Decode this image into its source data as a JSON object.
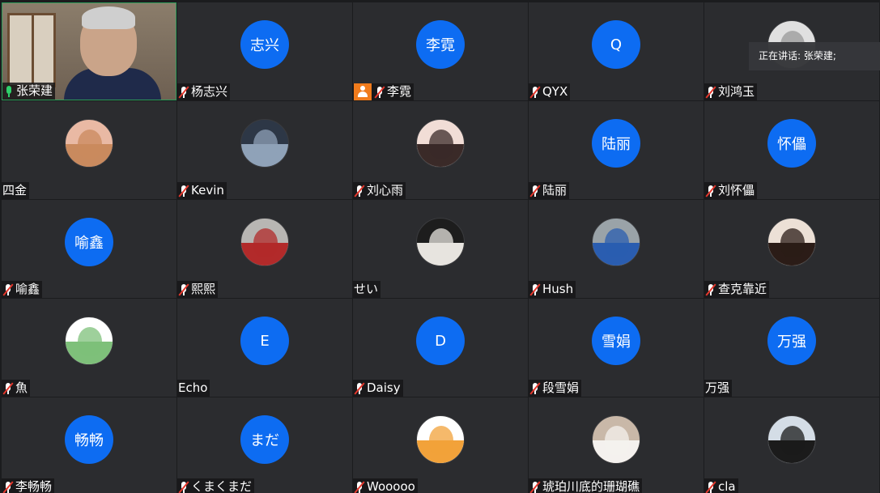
{
  "speaking_indicator": {
    "label": "正在讲话: 张荣建;"
  },
  "participants": [
    {
      "name": "张荣建",
      "kind": "video",
      "mic": "on",
      "active": true
    },
    {
      "name": "杨志兴",
      "kind": "initials",
      "initials": "志兴",
      "mic": "muted"
    },
    {
      "name": "李霓",
      "kind": "initials",
      "initials": "李霓",
      "mic": "muted",
      "host": true
    },
    {
      "name": "QYX",
      "kind": "initials",
      "initials": "Q",
      "mic": "muted"
    },
    {
      "name": "刘鸿玉",
      "kind": "photo",
      "mic": "muted",
      "photo_colors": [
        "#e0e0e0",
        "#9a9a9a"
      ]
    },
    {
      "name": "四金",
      "kind": "photo",
      "mic": "none",
      "photo_colors": [
        "#e9b9a4",
        "#c98a5e"
      ]
    },
    {
      "name": "Kevin",
      "kind": "photo",
      "mic": "muted",
      "photo_colors": [
        "#2d3746",
        "#8fa2b8"
      ]
    },
    {
      "name": "刘心雨",
      "kind": "photo",
      "mic": "muted",
      "photo_colors": [
        "#f1ddd6",
        "#3a2a28"
      ]
    },
    {
      "name": "陆丽",
      "kind": "initials",
      "initials": "陆丽",
      "mic": "muted"
    },
    {
      "name": "刘怀儡",
      "kind": "initials",
      "initials": "怀儡",
      "mic": "muted"
    },
    {
      "name": "喻鑫",
      "kind": "initials",
      "initials": "喻鑫",
      "mic": "muted"
    },
    {
      "name": "熙熙",
      "kind": "photo",
      "mic": "muted",
      "photo_colors": [
        "#b8b6b3",
        "#b22a2a"
      ]
    },
    {
      "name": "せい",
      "kind": "photo",
      "mic": "none",
      "photo_colors": [
        "#1d1d1d",
        "#e7e4df"
      ]
    },
    {
      "name": "Hush",
      "kind": "photo",
      "mic": "muted",
      "photo_colors": [
        "#9aa3a8",
        "#2a5db0"
      ]
    },
    {
      "name": "查克靠近",
      "kind": "photo",
      "mic": "muted",
      "photo_colors": [
        "#ece0d6",
        "#2b1c17"
      ]
    },
    {
      "name": "魚",
      "kind": "photo",
      "mic": "muted",
      "photo_colors": [
        "#ffffff",
        "#7ec07a"
      ]
    },
    {
      "name": "Echo",
      "kind": "initials",
      "initials": "E",
      "mic": "none"
    },
    {
      "name": "Daisy",
      "kind": "initials",
      "initials": "D",
      "mic": "muted"
    },
    {
      "name": "段雪娟",
      "kind": "initials",
      "initials": "雪娟",
      "mic": "muted"
    },
    {
      "name": "万强",
      "kind": "initials",
      "initials": "万强",
      "mic": "none"
    },
    {
      "name": "李畅畅",
      "kind": "initials",
      "initials": "畅畅",
      "mic": "muted"
    },
    {
      "name": "くまくまだ",
      "kind": "initials",
      "initials": "まだ",
      "mic": "muted"
    },
    {
      "name": "Wooooo",
      "kind": "photo",
      "mic": "muted",
      "photo_colors": [
        "#ffffff",
        "#f2a23a"
      ]
    },
    {
      "name": "琥珀川底的珊瑚礁",
      "kind": "photo",
      "mic": "muted",
      "photo_colors": [
        "#c9b8a8",
        "#f4f1ee"
      ]
    },
    {
      "name": "cla",
      "kind": "photo",
      "mic": "muted",
      "photo_colors": [
        "#d4dde6",
        "#1b1b1b"
      ]
    }
  ],
  "colors": {
    "initials_bg": "#0d6cf2",
    "tile_bg": "#2b2c2f",
    "active_border": "#2e9c5a",
    "mic_muted_slash": "#e5372c",
    "mic_on": "#2fd06b",
    "host_badge": "#f07b1c"
  },
  "icons": {
    "mic_muted": "mic-muted-icon",
    "mic_on": "mic-on-icon",
    "host": "host-badge-icon"
  }
}
